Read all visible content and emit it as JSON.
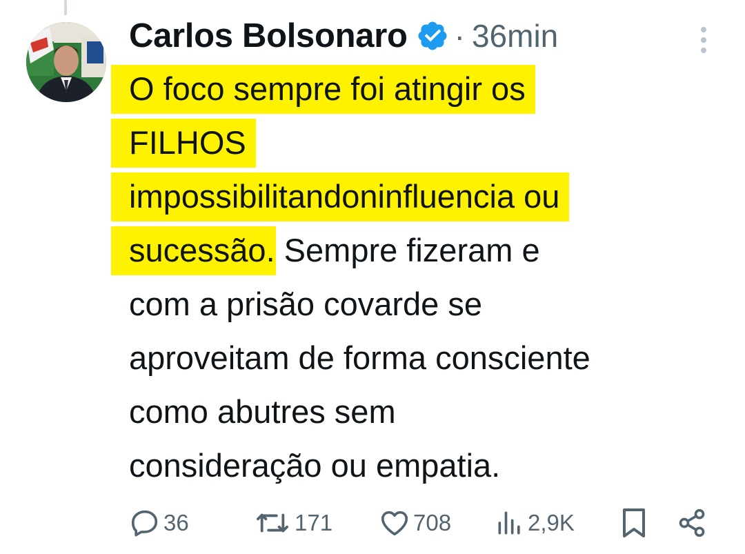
{
  "post": {
    "author": {
      "name": "Carlos Bolsonaro",
      "verified_icon": "verified-badge-icon",
      "avatar": "profile-avatar"
    },
    "separator": "·",
    "time": "36min",
    "text_lines": [
      {
        "highlighted": "O foco sempre foi atingir os",
        "rest": ""
      },
      {
        "highlighted": "FILHOS",
        "rest": ""
      },
      {
        "highlighted": "impossibilitandoninfluencia ou",
        "rest": ""
      },
      {
        "highlighted": "sucessão",
        "rest": ". Sempre fizeram e"
      },
      {
        "highlighted": "",
        "rest": "com a prisão covarde se"
      },
      {
        "highlighted": "",
        "rest": "aproveitam de forma consciente"
      },
      {
        "highlighted": "",
        "rest": "como abutres sem"
      },
      {
        "highlighted": "",
        "rest": "consideração ou empatia."
      }
    ],
    "highlight_color": "#fff200",
    "actions": {
      "replies": "36",
      "reposts": "171",
      "likes": "708",
      "views": "2,9K"
    }
  },
  "colors": {
    "text": "#0f1419",
    "muted": "#536471",
    "verified": "#1d9bf0"
  }
}
